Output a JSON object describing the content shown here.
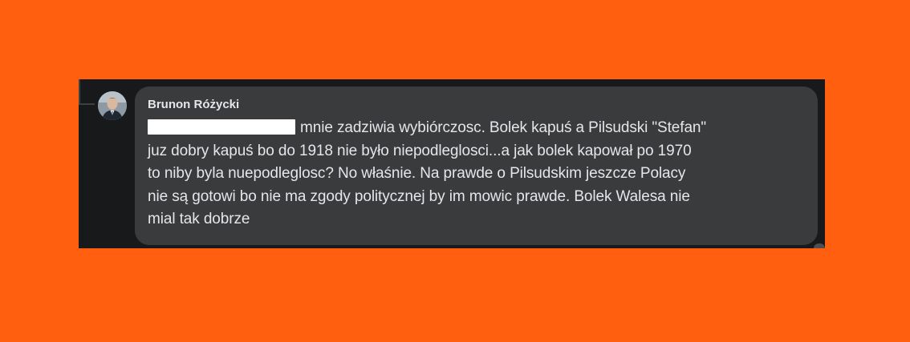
{
  "comment": {
    "author": "Brunon Różycki",
    "mention_redacted": true,
    "lines": [
      "mnie zadziwia wybiórczosc. Bolek kapuś a Pilsudski \"Stefan\"",
      "juz dobry kapuś bo do 1918 nie było niepodleglosci...a jak bolek kapował po 1970",
      "to niby byla nuepodleglosc? No właśnie. Na prawde o Pilsudskim jeszcze Polacy",
      "nie są gotowi bo nie ma zgody politycznej by im mowic prawde. Bolek Walesa nie",
      "mial tak dobrze"
    ]
  },
  "colors": {
    "page_background": "#ff5f0f",
    "panel_background": "#18191a",
    "bubble_background": "#3a3b3c",
    "text": "#e4e6eb",
    "redaction": "#ffffff"
  },
  "icons": {
    "avatar": "profile-photo"
  }
}
